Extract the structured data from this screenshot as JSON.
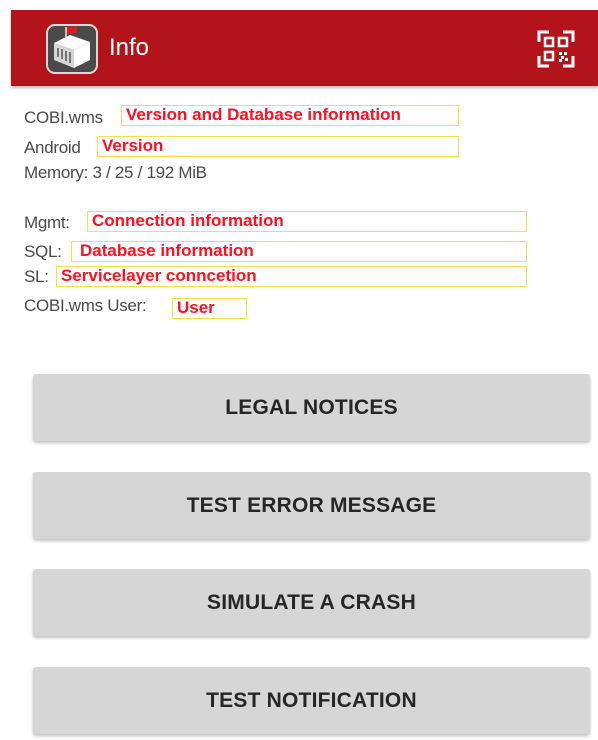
{
  "app_bar": {
    "title": "Info",
    "app_icon": "box-app-icon",
    "scan_icon": "qr-code-scan-icon",
    "background_color": "#b3141b"
  },
  "info": {
    "version_label": "COBI.wms",
    "version_annotation": "Version and Database information",
    "android_label": "Android",
    "android_annotation": "Version",
    "memory_text": "Memory: 3 / 25 / 192 MiB",
    "mgmt_label": "Mgmt:",
    "mgmt_annotation": "Connection information",
    "sql_label": "SQL:",
    "sql_annotation": "Database information",
    "sl_label": "SL:",
    "sl_annotation": "Servicelayer conncetion",
    "user_label": "COBI.wms User:",
    "user_annotation": "User",
    "annotation_color": "#ff1020",
    "annotation_border_color": "#f2e24a"
  },
  "buttons": {
    "legal_notices": "LEGAL NOTICES",
    "test_error": "TEST ERROR MESSAGE",
    "simulate_crash": "SIMULATE A CRASH",
    "test_notification": "TEST NOTIFICATION"
  }
}
